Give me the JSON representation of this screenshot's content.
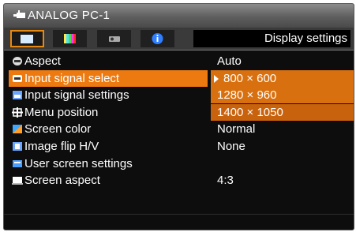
{
  "header": {
    "source_title": "ANALOG PC-1",
    "source_icon": "analog-pc-icon"
  },
  "tabs": {
    "items": [
      {
        "name": "display-tab",
        "icon": "screen-icon",
        "selected": true
      },
      {
        "name": "color-tab",
        "icon": "color-bars-icon",
        "selected": false
      },
      {
        "name": "setup-tab",
        "icon": "projector-icon",
        "selected": false
      },
      {
        "name": "info-tab",
        "icon": "info-icon",
        "selected": false
      }
    ],
    "panel_name": "Display settings"
  },
  "menu": {
    "items": [
      {
        "label": "Aspect",
        "value": "Auto",
        "icon": "aspect-icon"
      },
      {
        "label": "Input signal select",
        "value": "800 × 600",
        "icon": "input-signal-icon",
        "selected": true
      },
      {
        "label": "Input signal settings",
        "value": "1280 × 960",
        "icon": "signal-settings-icon"
      },
      {
        "label": "Menu position",
        "value": "1400 × 1050",
        "icon": "menu-position-icon"
      },
      {
        "label": "Screen color",
        "value": "Normal",
        "icon": "screen-color-icon"
      },
      {
        "label": "Image flip H/V",
        "value": "None",
        "icon": "image-flip-icon"
      },
      {
        "label": "User screen settings",
        "value": "",
        "icon": "user-screen-icon"
      },
      {
        "label": "Screen aspect",
        "value": "4:3",
        "icon": "screen-aspect-icon"
      }
    ]
  },
  "colors": {
    "accent": "#ed7a10",
    "background": "#0d0d0d",
    "titlebar": "#6e6e6e"
  }
}
